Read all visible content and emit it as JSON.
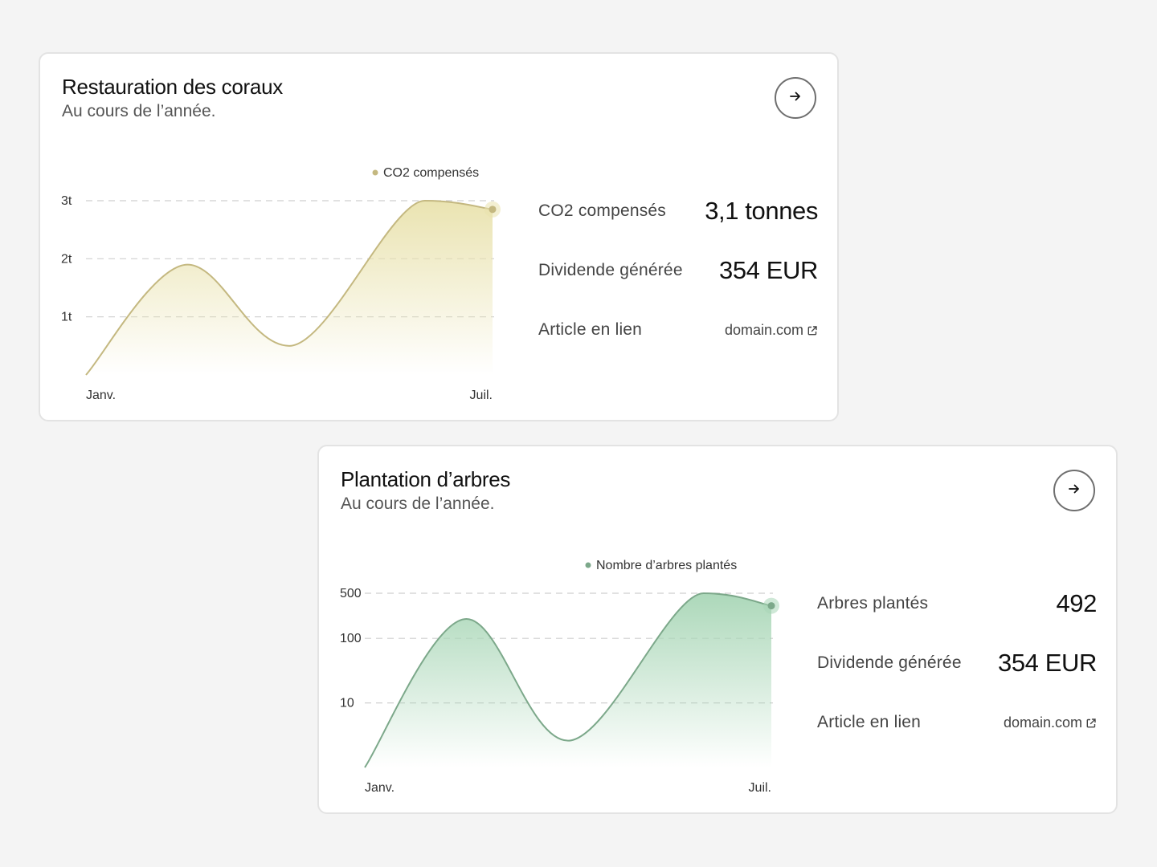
{
  "cards": [
    {
      "title": "Restauration des coraux",
      "subtitle": "Au cours de l’année.",
      "stats": [
        {
          "label": "CO2 compensés",
          "value": "3,1 tonnes"
        },
        {
          "label": "Dividende générée",
          "value": "354 EUR"
        },
        {
          "label": "Article en lien",
          "link": "domain.com"
        }
      ],
      "accent": "#c4b880",
      "fill": "#e9e2ad",
      "chart_data": {
        "type": "area",
        "series": [
          {
            "name": "CO2 compensés",
            "values": [
              0,
              1.9,
              0.5,
              3.0,
              2.85
            ]
          }
        ],
        "x": [
          "Janv.",
          "",
          "",
          "",
          "Juil."
        ],
        "x_pos": [
          0,
          1.5,
          3.0,
          5.0,
          6.0
        ],
        "xlim": [
          0,
          6
        ],
        "y_ticks": [
          "1t",
          "2t",
          "3t"
        ],
        "y_tick_values": [
          1,
          2,
          3
        ],
        "x_tick_labels": [
          "Janv.",
          "Juil."
        ],
        "ylim": [
          0,
          3.1
        ],
        "scale": "linear",
        "legend_position": "top",
        "grid": true
      }
    },
    {
      "title": "Plantation d’arbres",
      "subtitle": "Au cours de l’année.",
      "stats": [
        {
          "label": "Arbres plantés",
          "value": "492"
        },
        {
          "label": "Dividende générée",
          "value": "354 EUR"
        },
        {
          "label": "Article en lien",
          "link": "domain.com"
        }
      ],
      "accent": "#7ca88a",
      "fill": "#a8d6b6",
      "chart_data": {
        "type": "area",
        "series": [
          {
            "name": "Nombre d’arbres plantés",
            "values": [
              1,
              200,
              2.6,
              500,
              320
            ]
          }
        ],
        "x": [
          "Janv.",
          "",
          "",
          "",
          "Juil."
        ],
        "x_pos": [
          0,
          1.5,
          3.0,
          5.0,
          6.0
        ],
        "xlim": [
          0,
          6
        ],
        "y_ticks": [
          "10",
          "100",
          "500"
        ],
        "y_tick_values": [
          10,
          100,
          500
        ],
        "x_tick_labels": [
          "Janv.",
          "Juil."
        ],
        "ylim": [
          1,
          500
        ],
        "scale": "log",
        "legend_position": "top",
        "grid": true
      }
    }
  ]
}
